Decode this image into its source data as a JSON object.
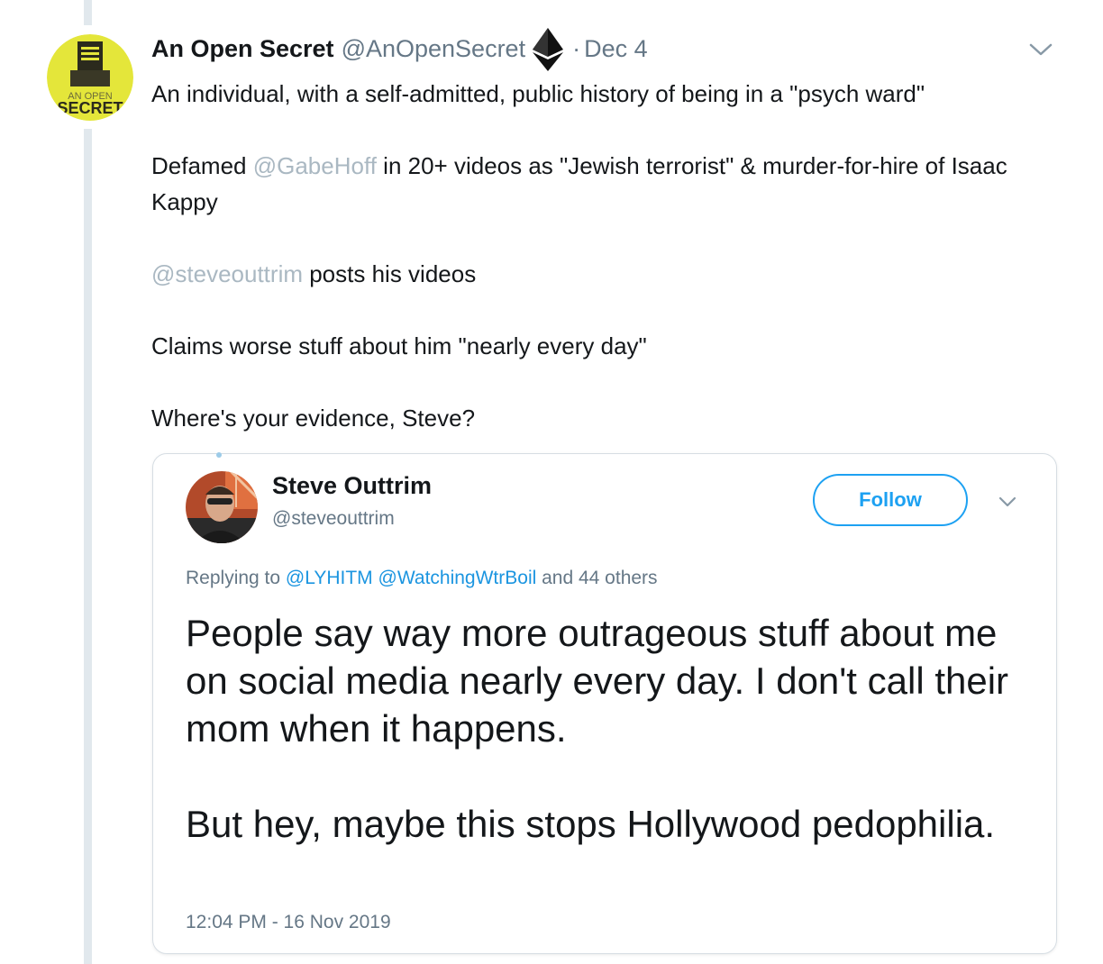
{
  "tweet": {
    "display_name": "An Open Secret",
    "handle": "@AnOpenSecret",
    "badge_icon": "ethereum-diamond-icon",
    "separator": "·",
    "date": "Dec 4",
    "avatar_text_top": "AN OPEN",
    "avatar_text_bottom": "SECRET",
    "avatar_color": "#e4e63a",
    "text": {
      "line1": "An individual, with a self-admitted, public history of being in a \"psych ward\"",
      "line2_prefix": "Defamed ",
      "line2_mention": "@GabeHoff",
      "line2_suffix": " in 20+ videos as \"Jewish terrorist\" &  murder-for-hire of Isaac Kappy",
      "line3_mention": "@steveouttrim",
      "line3_suffix": " posts his videos",
      "line4": "Claims worse stuff about him \"nearly every day\"",
      "line5": "Where's your evidence, Steve?"
    }
  },
  "quoted_tweet": {
    "display_name": "Steve Outtrim",
    "handle": "@steveouttrim",
    "follow_label": "Follow",
    "replying_prefix": "Replying to ",
    "replying_mention1": "@LYHITM",
    "replying_mention2": "@WatchingWtrBoil",
    "replying_suffix": " and 44 others",
    "text_p1": "People say way more outrageous stuff about me on social media nearly every day. I don't call their mom when it happens.",
    "text_p2": "But hey, maybe this stops Hollywood pedophilia.",
    "timestamp": "12:04 PM - 16 Nov 2019"
  },
  "colors": {
    "link_blue": "#1da1f2",
    "faded_mention": "#aab8c2",
    "secondary_text": "#657786",
    "thread_line": "#e1e8ed"
  }
}
